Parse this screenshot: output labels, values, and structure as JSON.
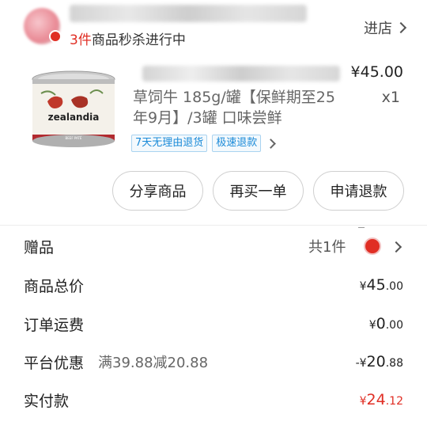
{
  "shop": {
    "enter_label": "进店",
    "flash_count": "3件",
    "flash_text": "商品秒杀进行中"
  },
  "product": {
    "title": "草饲牛 185g/罐【保鲜期至25年9月】/3罐 口味尝鲜",
    "price": "¥45.00",
    "quantity": "x1",
    "tags": [
      "7天无理由退货",
      "极速退款"
    ],
    "can_brand": "zealandia",
    "can_subtext": "BEEF PATÉ"
  },
  "actions": {
    "share": "分享商品",
    "rebuy": "再买一单",
    "refund": "申请退款"
  },
  "summary": {
    "gift_label": "赠品",
    "gift_count": "共1件",
    "total_label": "商品总价",
    "total_currency": "¥",
    "total_int": "45",
    "total_dec": ".00",
    "shipping_label": "订单运费",
    "shipping_currency": "¥",
    "shipping_int": "0",
    "shipping_dec": ".00",
    "discount_label": "平台优惠",
    "discount_desc": "满39.88减20.88",
    "discount_currency": "-¥",
    "discount_int": "20",
    "discount_dec": ".88",
    "paid_label": "实付款",
    "paid_currency": "¥",
    "paid_int": "24",
    "paid_dec": ".12"
  },
  "colors": {
    "accent_red": "#e02e24",
    "tag_blue": "#1a8ad8"
  }
}
